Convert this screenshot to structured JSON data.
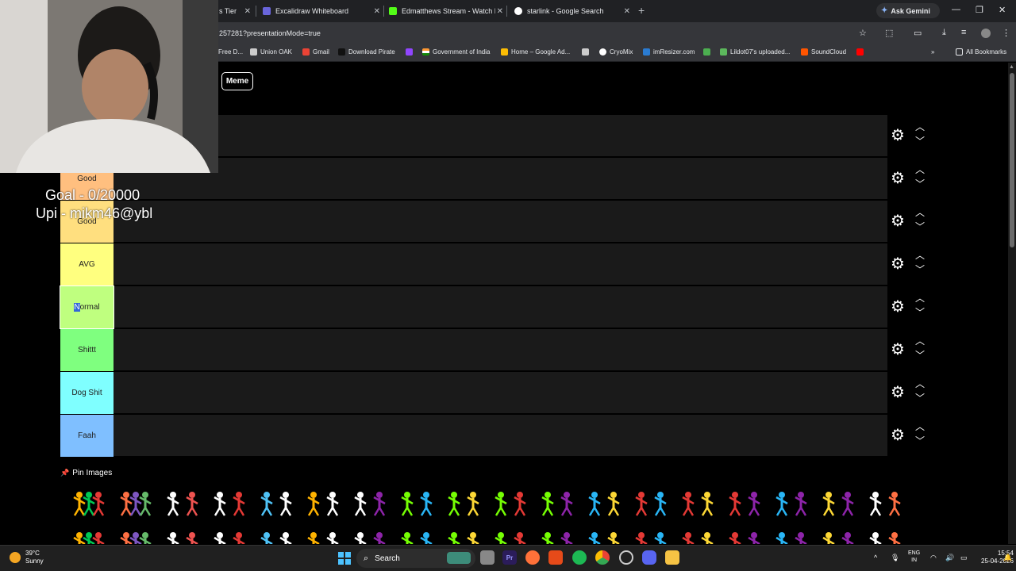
{
  "browser": {
    "tabs": [
      {
        "label": "s Tier",
        "color": "#8ab4f8"
      },
      {
        "label": "Excalidraw Whiteboard",
        "color": "#6965db"
      },
      {
        "label": "Edmatthews Stream - Watch Li",
        "color": "#53fc18"
      },
      {
        "label": "starlink - Google Search",
        "color": "#ffffff"
      }
    ],
    "ask_gemini": "Ask Gemini",
    "url": "257281?presentationMode=true",
    "bookmarks": [
      {
        "label": "Free D...",
        "color": "#888888"
      },
      {
        "label": "Union OAK",
        "color": "#cccccc"
      },
      {
        "label": "Gmail",
        "color": "#ea4335"
      },
      {
        "label": "Download Pirate",
        "color": "#222222"
      },
      {
        "label": "",
        "color": "#9146ff"
      },
      {
        "label": "Government of India",
        "color": "#ff9933"
      },
      {
        "label": "Home – Google Ad...",
        "color": "#fbbc04"
      },
      {
        "label": "",
        "color": "#cccccc"
      },
      {
        "label": "CryoMix",
        "color": "#ffffff"
      },
      {
        "label": "imResizer.com",
        "color": "#2a7bd1"
      },
      {
        "label": "",
        "color": "#4caf50"
      },
      {
        "label": "Lildot07's uploaded...",
        "color": "#5cb85c"
      },
      {
        "label": "SoundCloud",
        "color": "#ff5500"
      },
      {
        "label": "",
        "color": "#ff0000"
      }
    ],
    "all_bookmarks": "All Bookmarks"
  },
  "page": {
    "meme_button": "Meme",
    "tiers": [
      {
        "label": "",
        "color": "#1a1a1a"
      },
      {
        "label": "Good",
        "color": "#ffbf7f"
      },
      {
        "label": "Good",
        "color": "#ffdf7f"
      },
      {
        "label": "AVG",
        "color": "#ffff7f"
      },
      {
        "label_sel": "N",
        "label_rest": "ormal",
        "color": "#bfff7f"
      },
      {
        "label": "Shittt",
        "color": "#7fff7f"
      },
      {
        "label": "Dog Shit",
        "color": "#7fffff"
      },
      {
        "label": "Faah",
        "color": "#7fbfff"
      }
    ],
    "pin_images": "Pin Images",
    "figure_colors_row1": [
      "#ffb300|#00c853|#e53935",
      "#ff7043|#7e57c2|#66bb6a",
      "#ffffff|#ef5350",
      "#ffffff|#e53935",
      "#4fc3f7|#ffffff",
      "#ffb300|#ffffff",
      "#ffffff|#8e24aa",
      "#76ff03|#29b6f6",
      "#76ff03|#fdd835",
      "#76ff03|#e53935",
      "#76ff03|#8e24aa",
      "#29b6f6|#fdd835",
      "#e53935|#29b6f6",
      "#e53935|#fdd835",
      "#e53935|#8e24aa",
      "#29b6f6|#8e24aa",
      "#fdd835|#8e24aa",
      "#ffffff|#ff7043"
    ]
  },
  "overlay": {
    "goal": "Goal - 0/20000",
    "upi": "Upi - mikm46@ybl"
  },
  "taskbar": {
    "temp": "39°C",
    "weather": "Sunny",
    "search": "Search",
    "lang_line1": "ENG",
    "lang_line2": "IN",
    "time": "15:54",
    "date": "25-04-2026"
  }
}
